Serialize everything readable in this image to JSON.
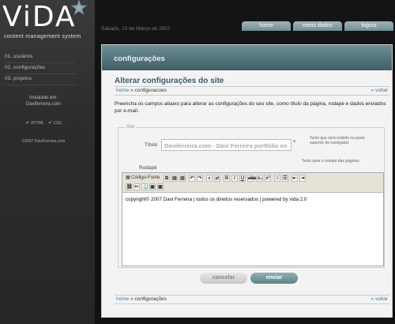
{
  "brand": {
    "name": "ViDA",
    "tagline": "content management system"
  },
  "sidebar": {
    "items": [
      {
        "label": "01. usuários"
      },
      {
        "label": "02. configurações"
      },
      {
        "label": "03. projetos"
      }
    ],
    "installed_label": "Instalado em:",
    "installed_site": "Daviferreira.com",
    "badges": [
      "XHTML",
      "CSS"
    ],
    "copyright": "©2007 DaviFerreira.com"
  },
  "header": {
    "date": "Sábado, 10 de Março de 2007",
    "tabs": [
      {
        "label": "home"
      },
      {
        "label": "meus dados"
      },
      {
        "label": "logout"
      }
    ]
  },
  "panel": {
    "title": "configurações",
    "section_title": "Alterar configurações do site",
    "breadcrumb_home": "home",
    "breadcrumb_sep": " » ",
    "breadcrumb_top": "configuracoes",
    "breadcrumb_bottom": "configurações",
    "back_label": "voltar",
    "intro": "Preencha os campos abaixo para alterar as configurações do seu site, como título da página, rodapé e dados enviados por e-mail.",
    "fieldset_legend": "Site",
    "title_label": "Título",
    "title_value": "Daviferreira.com - Davi Ferreira portfólio on",
    "required_mark": "*",
    "title_hint": "Texto que será exibido na parte superior do navegador",
    "footer_label": "Rodapé",
    "footer_hint": "Texto para o rodapé das páginas",
    "editor": {
      "source_label": "Código-Fonte",
      "content": "copyright© 2007 Davi Ferreira | todos os direitos reservados | powered by vida 2.0"
    },
    "cancel_label": "cancelar",
    "submit_label": "enviar"
  }
}
